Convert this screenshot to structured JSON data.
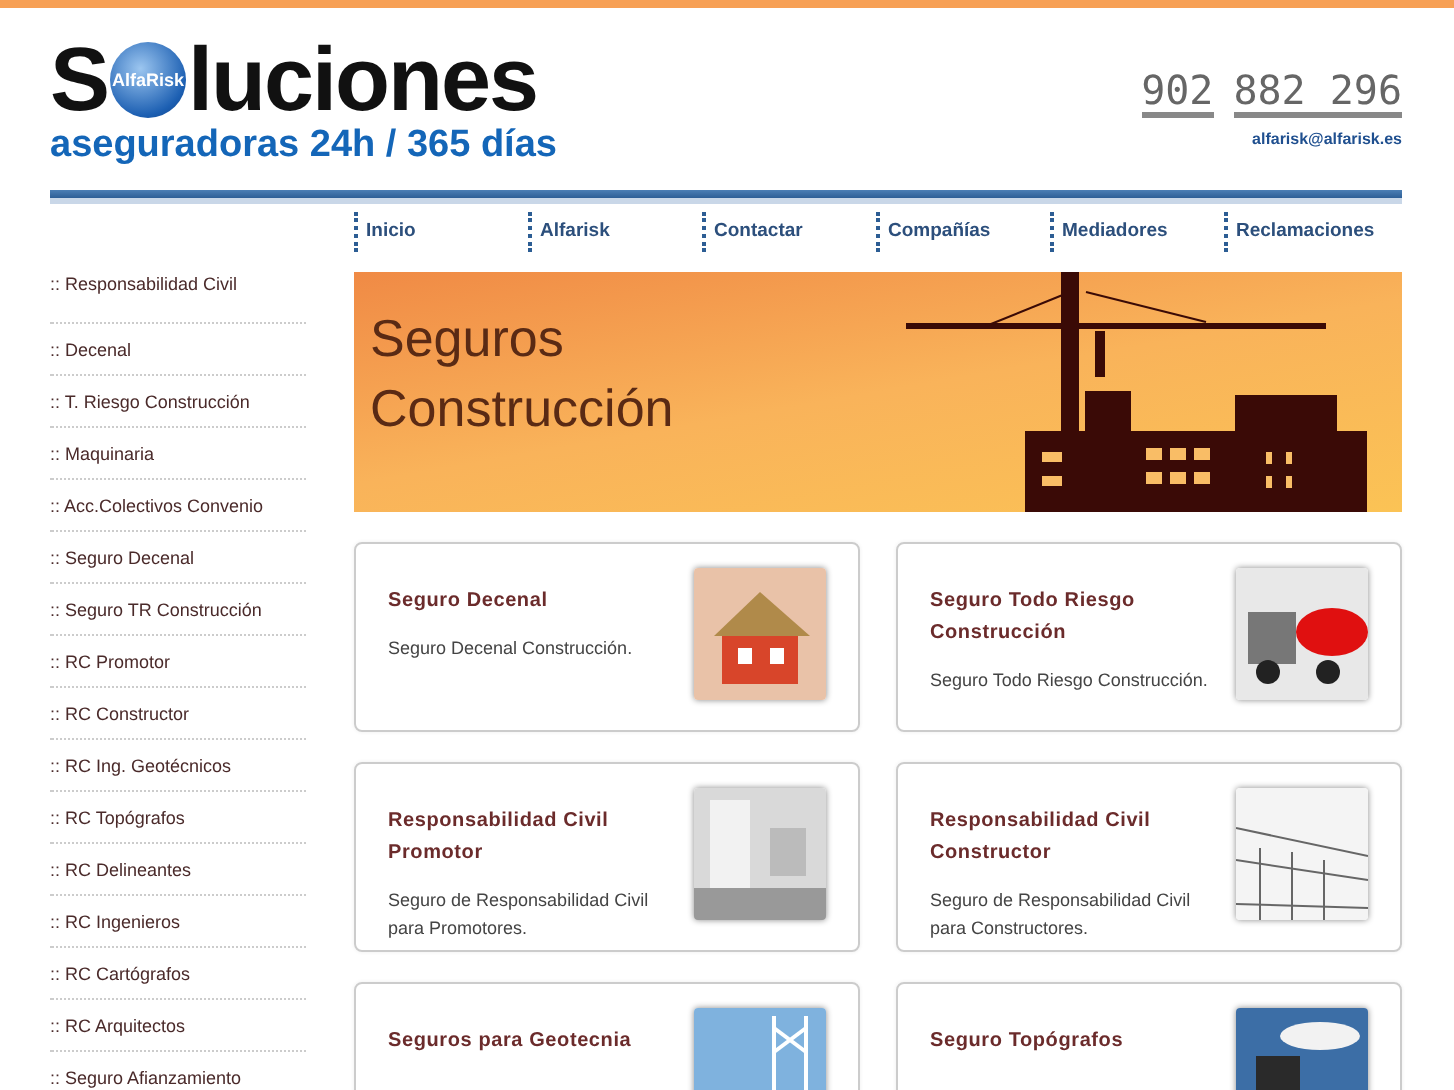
{
  "logo": {
    "brand": "S",
    "brand_rest": "luciones",
    "badge": "AlfaRisk",
    "tagline": "aseguradoras 24h / 365 días"
  },
  "contact": {
    "phone_prefix": "902",
    "phone_number": "882 296",
    "email": "alfarisk@alfarisk.es"
  },
  "nav": [
    "Inicio",
    "Alfarisk",
    "Contactar",
    "Compañías",
    "Mediadores",
    "Reclamaciones"
  ],
  "sidebar": {
    "items": [
      ":: Responsabilidad Civil",
      ":: Decenal",
      ":: T. Riesgo Construcción",
      ":: Maquinaria",
      ":: Acc.Colectivos Convenio",
      ":: Seguro Decenal",
      ":: Seguro TR Construcción",
      ":: RC Promotor",
      ":: RC Constructor",
      ":: RC Ing. Geotécnicos",
      ":: RC Topógrafos",
      ":: RC Delineantes",
      ":: RC Ingenieros",
      ":: RC Cartógrafos",
      ":: RC Arquitectos",
      ":: Seguro Afianzamiento"
    ]
  },
  "banner": {
    "title_line1": "Seguros",
    "title_line2": "Construcción"
  },
  "cards": [
    {
      "title": "Seguro Decenal",
      "text": "Seguro Decenal Construcción.",
      "kind": "house"
    },
    {
      "title": "Seguro Todo Riesgo Construcción",
      "text": "Seguro Todo Riesgo Construcción.",
      "kind": "truck"
    },
    {
      "title": "Responsabilidad Civil Promotor",
      "text": "Seguro de Responsabilidad Civil para Promotores.",
      "kind": "room"
    },
    {
      "title": "Responsabilidad Civil Constructor",
      "text": "Seguro de Responsabilidad Civil para Constructores.",
      "kind": "structure"
    },
    {
      "title": "Seguros para Geotecnia",
      "kind": "bridge"
    },
    {
      "title": "Seguro Topógrafos",
      "kind": "worker"
    }
  ]
}
